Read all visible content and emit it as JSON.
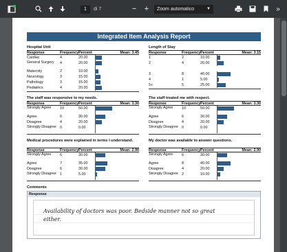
{
  "toolbar": {
    "page_current": "1",
    "page_total": "di 7",
    "zoom_label": "Zoom automatico",
    "minus": "−",
    "plus": "+",
    "more": "»"
  },
  "report": {
    "title": "Integrated Item Analysis Report",
    "sections": [
      {
        "title": "Hospital Unit",
        "headers": [
          "Response",
          "Frequency",
          "Percent",
          "Mean: 3.45"
        ],
        "rows": [
          {
            "label": "Cardiac",
            "freq": "4",
            "pct": "20.00",
            "value": 20
          },
          {
            "label": "General Surgery",
            "freq": "4",
            "pct": "20.00",
            "value": 20
          },
          {
            "label": "Maternity",
            "freq": "2",
            "pct": "10.00",
            "value": 10
          },
          {
            "label": "Neurology",
            "freq": "3",
            "pct": "15.00",
            "value": 15
          },
          {
            "label": "Pathology",
            "freq": "3",
            "pct": "15.00",
            "value": 15
          },
          {
            "label": "Pediatrics",
            "freq": "4",
            "pct": "20.00",
            "value": 20
          }
        ]
      },
      {
        "title": "Length of Stay",
        "headers": [
          "Response",
          "Frequency",
          "Percent",
          "Mean: 3.15"
        ],
        "rows": [
          {
            "label": "1",
            "freq": "2",
            "pct": "10.00",
            "value": 10
          },
          {
            "label": "2",
            "freq": "4",
            "pct": "20.00",
            "value": 20
          },
          {
            "label": "",
            "freq": "",
            "pct": "",
            "value": null
          },
          {
            "label": "3",
            "freq": "8",
            "pct": "40.00",
            "value": 40
          },
          {
            "label": "4",
            "freq": "1",
            "pct": "5.00",
            "value": 5
          },
          {
            "label": "5+",
            "freq": "5",
            "pct": "25.00",
            "value": 25
          }
        ]
      },
      {
        "title": "The staff was responsive to my needs.",
        "headers": [
          "Response",
          "Frequency",
          "Percent",
          "Mean: 3.30"
        ],
        "rows": [
          {
            "label": "Strongly Agree",
            "freq": "10",
            "pct": "50.00",
            "value": 50
          },
          {
            "label": "Agree",
            "freq": "6",
            "pct": "30.00",
            "value": 30
          },
          {
            "label": "Disagree",
            "freq": "4",
            "pct": "20.00",
            "value": 20
          },
          {
            "label": "Strongly Disagree",
            "freq": "0",
            "pct": "0.00",
            "value": 0
          }
        ]
      },
      {
        "title": "The staff treated me with respect.",
        "headers": [
          "Response",
          "Frequency",
          "Percent",
          "Mean: 3.30"
        ],
        "rows": [
          {
            "label": "Strongly Agree",
            "freq": "10",
            "pct": "50.00",
            "value": 50
          },
          {
            "label": "Agree",
            "freq": "6",
            "pct": "30.00",
            "value": 30
          },
          {
            "label": "Disagree",
            "freq": "4",
            "pct": "20.00",
            "value": 20
          },
          {
            "label": "Strongly Disagree",
            "freq": "0",
            "pct": "0.00",
            "value": 0
          }
        ]
      },
      {
        "title": "Medical procedures were explained in terms I understand.",
        "headers": [
          "Response",
          "Frequency",
          "Percent",
          "Mean: 2.90"
        ],
        "rows": [
          {
            "label": "Strongly Agree",
            "freq": "6",
            "pct": "30.00",
            "value": 30
          },
          {
            "label": "Agree",
            "freq": "7",
            "pct": "35.00",
            "value": 35
          },
          {
            "label": "Disagree",
            "freq": "6",
            "pct": "30.00",
            "value": 30
          },
          {
            "label": "Strongly Disagree",
            "freq": "1",
            "pct": "5.00",
            "value": 5
          }
        ]
      },
      {
        "title": "My doctor was available to answer questions.",
        "headers": [
          "Response",
          "Frequency",
          "Percent",
          "Mean: 2.90"
        ],
        "rows": [
          {
            "label": "Strongly Agree",
            "freq": "6",
            "pct": "30.00",
            "value": 30
          },
          {
            "label": "Agree",
            "freq": "8",
            "pct": "40.00",
            "value": 40
          },
          {
            "label": "Disagree",
            "freq": "4",
            "pct": "20.00",
            "value": 20
          },
          {
            "label": "Strongly Disagree",
            "freq": "2",
            "pct": "10.00",
            "value": 10
          }
        ]
      }
    ],
    "comments": {
      "title": "Comments",
      "header": "Response",
      "handwritten": "Availability of doctors was poor. Bedside manner not so great either."
    }
  },
  "colors": {
    "banner": "#2f5d8a",
    "bar": "#2f5d8a",
    "toolbar": "#323639",
    "viewer_bg": "#525659"
  },
  "icons": [
    "sidebar-toggle-icon",
    "search-icon",
    "arrow-up-icon",
    "arrow-down-icon",
    "print-icon",
    "save-icon",
    "bookmark-icon"
  ]
}
